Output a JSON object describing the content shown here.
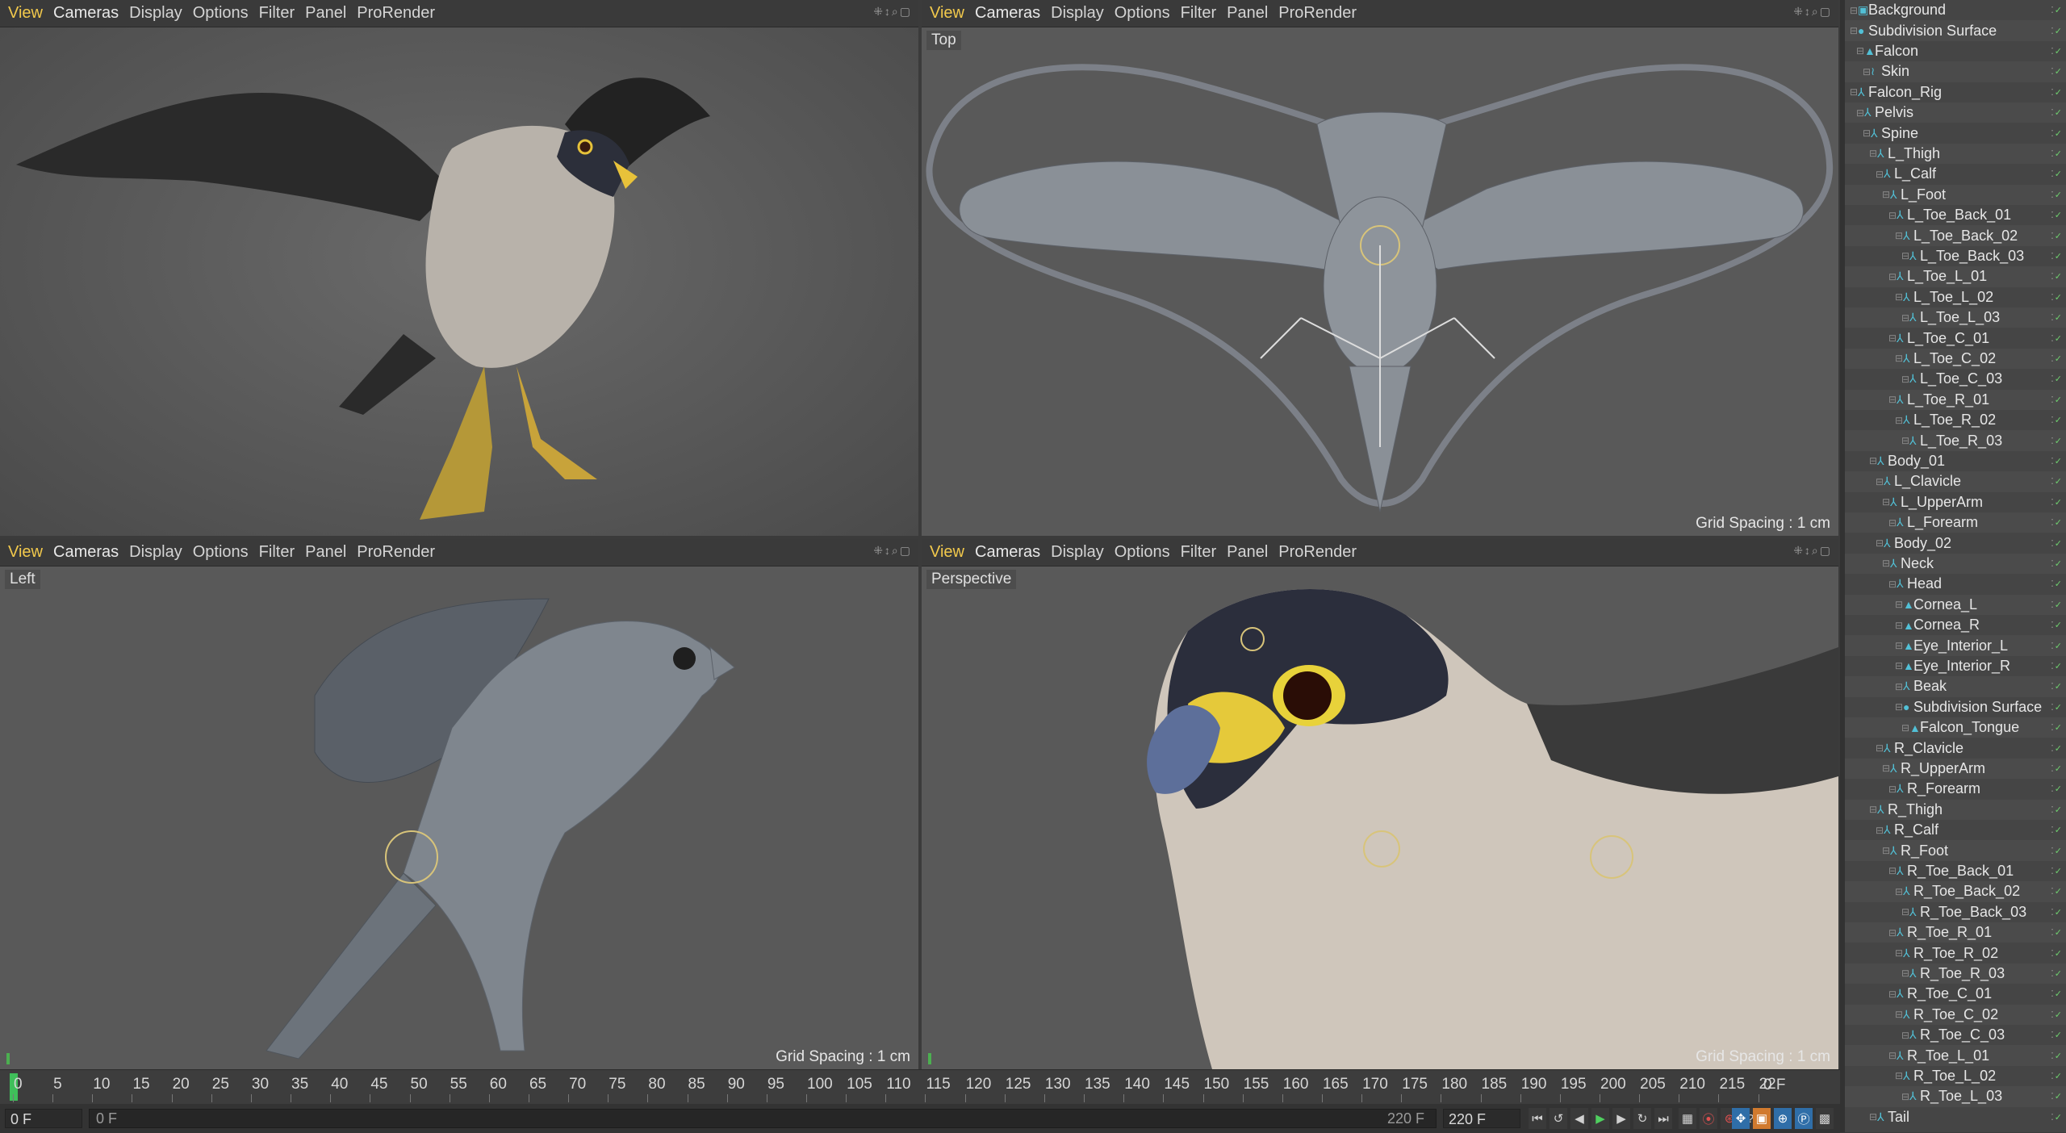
{
  "viewport_menu": [
    "View",
    "Cameras",
    "Display",
    "Options",
    "Filter",
    "Panel",
    "ProRender"
  ],
  "viewport_ctrls": "⁜↕⌕▢",
  "viewports": {
    "top_left": {
      "label": ""
    },
    "top_right": {
      "label": "Top",
      "grid": "Grid Spacing : 1 cm"
    },
    "bottom_left": {
      "label": "Left",
      "grid": "Grid Spacing : 1 cm"
    },
    "bottom_right": {
      "label": "Perspective",
      "grid": "Grid Spacing : 1 cm"
    }
  },
  "object_manager": {
    "items": [
      {
        "name": "Background",
        "depth": 0,
        "icon": "background-icon"
      },
      {
        "name": "Subdivision Surface",
        "depth": 0,
        "icon": "subdivision-icon"
      },
      {
        "name": "Falcon",
        "depth": 1,
        "icon": "polygon-icon"
      },
      {
        "name": "Skin",
        "depth": 2,
        "icon": "skin-icon"
      },
      {
        "name": "Falcon_Rig",
        "depth": 0,
        "icon": "joint-icon"
      },
      {
        "name": "Pelvis",
        "depth": 1,
        "icon": "joint-icon"
      },
      {
        "name": "Spine",
        "depth": 2,
        "icon": "joint-icon"
      },
      {
        "name": "L_Thigh",
        "depth": 3,
        "icon": "joint-icon"
      },
      {
        "name": "L_Calf",
        "depth": 4,
        "icon": "joint-icon"
      },
      {
        "name": "L_Foot",
        "depth": 5,
        "icon": "joint-icon"
      },
      {
        "name": "L_Toe_Back_01",
        "depth": 6,
        "icon": "joint-icon"
      },
      {
        "name": "L_Toe_Back_02",
        "depth": 7,
        "icon": "joint-icon"
      },
      {
        "name": "L_Toe_Back_03",
        "depth": 8,
        "icon": "joint-icon"
      },
      {
        "name": "L_Toe_L_01",
        "depth": 6,
        "icon": "joint-icon"
      },
      {
        "name": "L_Toe_L_02",
        "depth": 7,
        "icon": "joint-icon"
      },
      {
        "name": "L_Toe_L_03",
        "depth": 8,
        "icon": "joint-icon"
      },
      {
        "name": "L_Toe_C_01",
        "depth": 6,
        "icon": "joint-icon"
      },
      {
        "name": "L_Toe_C_02",
        "depth": 7,
        "icon": "joint-icon"
      },
      {
        "name": "L_Toe_C_03",
        "depth": 8,
        "icon": "joint-icon"
      },
      {
        "name": "L_Toe_R_01",
        "depth": 6,
        "icon": "joint-icon"
      },
      {
        "name": "L_Toe_R_02",
        "depth": 7,
        "icon": "joint-icon"
      },
      {
        "name": "L_Toe_R_03",
        "depth": 8,
        "icon": "joint-icon"
      },
      {
        "name": "Body_01",
        "depth": 3,
        "icon": "joint-icon"
      },
      {
        "name": "L_Clavicle",
        "depth": 4,
        "icon": "joint-icon"
      },
      {
        "name": "L_UpperArm",
        "depth": 5,
        "icon": "joint-icon"
      },
      {
        "name": "L_Forearm",
        "depth": 6,
        "icon": "joint-icon"
      },
      {
        "name": "Body_02",
        "depth": 4,
        "icon": "joint-icon"
      },
      {
        "name": "Neck",
        "depth": 5,
        "icon": "joint-icon"
      },
      {
        "name": "Head",
        "depth": 6,
        "icon": "joint-icon"
      },
      {
        "name": "Cornea_L",
        "depth": 7,
        "icon": "polygon-icon"
      },
      {
        "name": "Cornea_R",
        "depth": 7,
        "icon": "polygon-icon"
      },
      {
        "name": "Eye_Interior_L",
        "depth": 7,
        "icon": "polygon-icon"
      },
      {
        "name": "Eye_Interior_R",
        "depth": 7,
        "icon": "polygon-icon"
      },
      {
        "name": "Beak",
        "depth": 7,
        "icon": "joint-icon"
      },
      {
        "name": "Subdivision Surface",
        "depth": 7,
        "icon": "subdivision-icon"
      },
      {
        "name": "Falcon_Tongue",
        "depth": 8,
        "icon": "polygon-icon"
      },
      {
        "name": "R_Clavicle",
        "depth": 4,
        "icon": "joint-icon"
      },
      {
        "name": "R_UpperArm",
        "depth": 5,
        "icon": "joint-icon"
      },
      {
        "name": "R_Forearm",
        "depth": 6,
        "icon": "joint-icon"
      },
      {
        "name": "R_Thigh",
        "depth": 3,
        "icon": "joint-icon"
      },
      {
        "name": "R_Calf",
        "depth": 4,
        "icon": "joint-icon"
      },
      {
        "name": "R_Foot",
        "depth": 5,
        "icon": "joint-icon"
      },
      {
        "name": "R_Toe_Back_01",
        "depth": 6,
        "icon": "joint-icon"
      },
      {
        "name": "R_Toe_Back_02",
        "depth": 7,
        "icon": "joint-icon"
      },
      {
        "name": "R_Toe_Back_03",
        "depth": 8,
        "icon": "joint-icon"
      },
      {
        "name": "R_Toe_R_01",
        "depth": 6,
        "icon": "joint-icon"
      },
      {
        "name": "R_Toe_R_02",
        "depth": 7,
        "icon": "joint-icon"
      },
      {
        "name": "R_Toe_R_03",
        "depth": 8,
        "icon": "joint-icon"
      },
      {
        "name": "R_Toe_C_01",
        "depth": 6,
        "icon": "joint-icon"
      },
      {
        "name": "R_Toe_C_02",
        "depth": 7,
        "icon": "joint-icon"
      },
      {
        "name": "R_Toe_C_03",
        "depth": 8,
        "icon": "joint-icon"
      },
      {
        "name": "R_Toe_L_01",
        "depth": 6,
        "icon": "joint-icon"
      },
      {
        "name": "R_Toe_L_02",
        "depth": 7,
        "icon": "joint-icon"
      },
      {
        "name": "R_Toe_L_03",
        "depth": 8,
        "icon": "joint-icon"
      },
      {
        "name": "Tail",
        "depth": 3,
        "icon": "joint-icon"
      }
    ]
  },
  "timeline": {
    "ticks": [
      "0",
      "5",
      "10",
      "15",
      "20",
      "25",
      "30",
      "35",
      "40",
      "45",
      "50",
      "55",
      "60",
      "65",
      "70",
      "75",
      "80",
      "85",
      "90",
      "95",
      "100",
      "105",
      "110",
      "115",
      "120",
      "125",
      "130",
      "135",
      "140",
      "145",
      "150",
      "155",
      "160",
      "165",
      "170",
      "175",
      "180",
      "185",
      "190",
      "195",
      "200",
      "205",
      "210",
      "215",
      "22"
    ],
    "current_frame_readout": "0 F",
    "current": "0 F",
    "slider_start": "0 F",
    "slider_end": "220 F",
    "end_field": "220 F"
  },
  "colors": {
    "accent": "#f2c94c",
    "playhead": "#3fbf5a",
    "joint": "#52c0d6"
  }
}
